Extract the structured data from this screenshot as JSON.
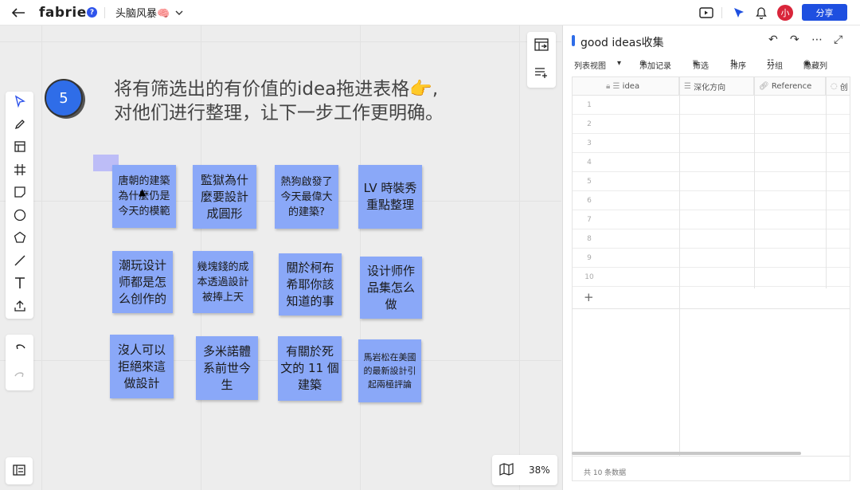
{
  "header": {
    "back_icon": "arrow-left-icon",
    "logo": "fabrie",
    "help_label": "?",
    "board_title": "头脑风暴🧠",
    "share_label": "分享",
    "avatar_label": "小"
  },
  "canvas": {
    "step_number": "5",
    "instruction_line1": "将有筛选出的有价值的idea拖进表格👉,",
    "instruction_line2": "对他们进行整理，让下一步工作更明确。",
    "zoom_label": "38%",
    "notes": [
      {
        "text": "唐朝的建築為什麼仍是今天的模範"
      },
      {
        "text": "監獄為什麼要設計成圓形"
      },
      {
        "text": "熱狗啟發了今天最偉大的建築?"
      },
      {
        "text": "LV 時裝秀重點整理"
      },
      {
        "text": "潮玩设计师都是怎么创作的"
      },
      {
        "text": "幾塊錢的成本透過設計被捧上天"
      },
      {
        "text": "關於柯布希耶你該知道的事"
      },
      {
        "text": "设计师作品集怎么做"
      },
      {
        "text": "沒人可以拒絕來這做設計"
      },
      {
        "text": "多米諾體系前世今生"
      },
      {
        "text": "有關於死文的 11 個建築"
      },
      {
        "text": "馬岩松在美國的最新設計引起兩極評論"
      }
    ]
  },
  "panel": {
    "title": "good ideas收集",
    "view_label": "列表视图",
    "add_record": "添加记录",
    "filter": "筛选",
    "sort": "排序",
    "group": "分组",
    "hide_cols": "隐藏列",
    "columns": [
      "idea",
      "深化方向",
      "Reference",
      "创"
    ],
    "rows": [
      "1",
      "2",
      "3",
      "4",
      "5",
      "6",
      "7",
      "8",
      "9",
      "10"
    ],
    "add_row": "+",
    "footer": "共 10 条数据"
  }
}
